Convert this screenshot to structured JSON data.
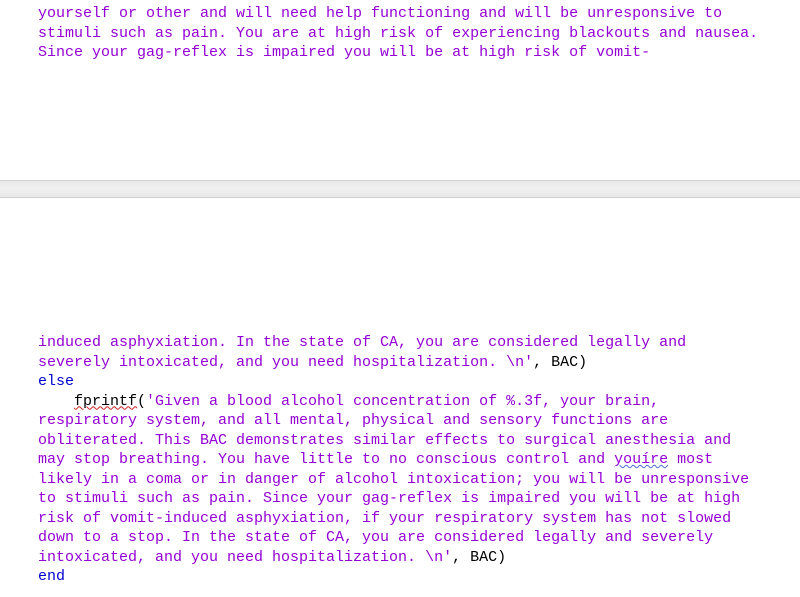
{
  "top_section": {
    "string_text": "yourself or other and will need help functioning and will be unresponsive to stimuli such as pain. You are at high risk of experiencing blackouts and nausea. Since your gag-reflex is impaired you will be at high risk of vomit-"
  },
  "bottom_section": {
    "cont_string": "induced asphyxiation. In the state of CA, you are considered legally and severely intoxicated, and you need hospitalization. \\n'",
    "comma_var_1": ", BAC)",
    "keyword_else": "else",
    "func_fprintf": "fprintf",
    "open_paren": "(",
    "string2_part1": "'Given a blood alcohol concentration of %.3f, your brain, respiratory system, and all mental, physical and sensory functions are obliterated. This BAC demonstrates similar effects to surgical anesthesia and may stop breathing. You have little to no conscious control and ",
    "string2_squiggle": "youíre",
    "string2_part2": " most likely in a coma or in danger of alcohol intoxication; you will be unresponsive to stimuli such as pain. Since your gag-reflex is impaired you will be at high risk of vomit-induced asphyxiation, if your respiratory system has not slowed down to a stop. In the state of CA, you are considered legally and severely intoxicated, and you need hospitalization. \\n'",
    "comma_var_2": ", BAC)",
    "keyword_end": "end"
  }
}
